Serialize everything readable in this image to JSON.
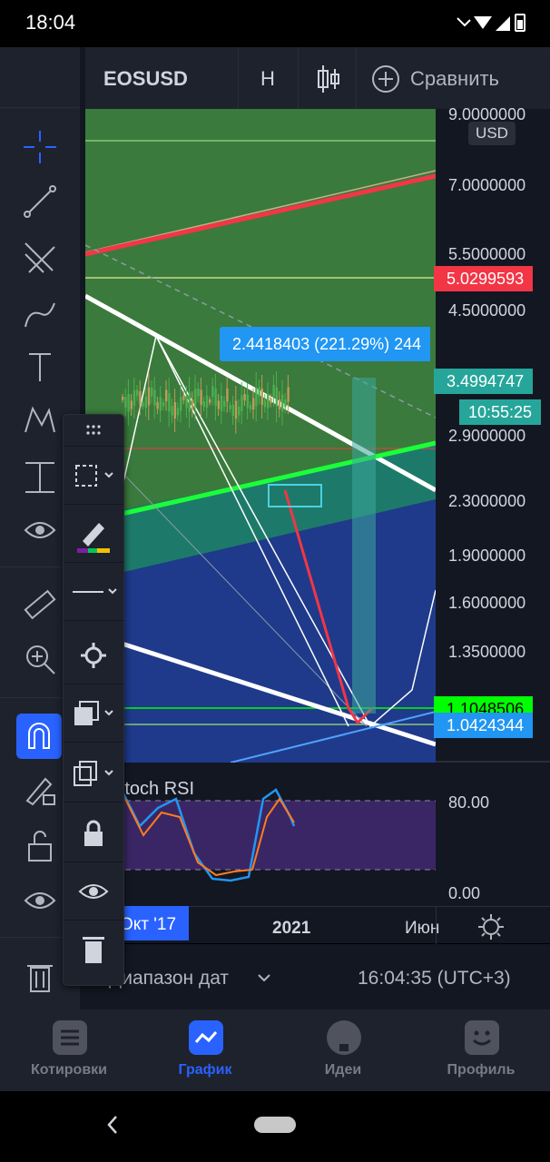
{
  "status_bar": {
    "time": "18:04"
  },
  "toolbar": {
    "symbol": "EOSUSD",
    "interval": "H",
    "compare_label": "Сравнить"
  },
  "price_axis": {
    "currency": "USD",
    "ticks": [
      "9.0000000",
      "7.0000000",
      "5.5000000",
      "4.5000000",
      "2.9000000",
      "2.3000000",
      "1.9000000",
      "1.6000000",
      "1.3500000"
    ],
    "labels": {
      "red": "5.0299593",
      "teal": "3.4994747",
      "countdown": "10:55:25",
      "green": "1.1048506",
      "blue": "1.0424344"
    },
    "colors": {
      "red": "#f23645",
      "teal": "#26a69a",
      "green": "#00ff00",
      "blue": "#2196f3"
    }
  },
  "chart": {
    "measure_label": "2.4418403 (221.29%) 244",
    "indicator_name": "Stoch RSI",
    "rsi_ticks": [
      "80.00",
      "0.00"
    ]
  },
  "time_axis": {
    "labels": [
      "Окт '17",
      "2021",
      "Июн"
    ]
  },
  "date_range": {
    "label": "Диапазон дат",
    "clock": "16:04:35 (UTC+3)"
  },
  "bottom_nav": {
    "items": [
      {
        "label": "Котировки",
        "icon": "quotes-icon"
      },
      {
        "label": "График",
        "icon": "chart-icon"
      },
      {
        "label": "Идеи",
        "icon": "ideas-icon"
      },
      {
        "label": "Профиль",
        "icon": "profile-icon"
      }
    ],
    "active": "График",
    "accent": "#2962ff"
  }
}
